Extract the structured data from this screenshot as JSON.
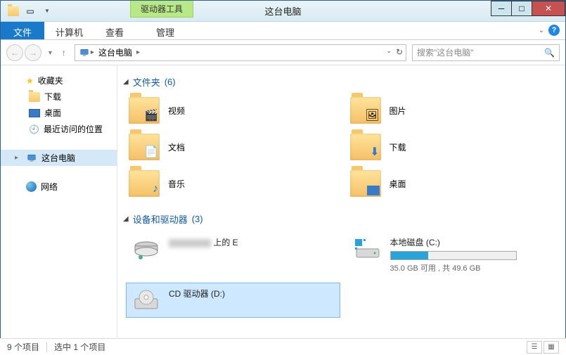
{
  "window": {
    "title": "这台电脑",
    "context_tab": "驱动器工具"
  },
  "ribbon": {
    "file": "文件",
    "tabs": [
      "计算机",
      "查看",
      "管理"
    ]
  },
  "nav": {
    "breadcrumb_root": "这台电脑",
    "search_placeholder": "搜索\"这台电脑\""
  },
  "sidebar": {
    "favorites": {
      "label": "收藏夹",
      "items": [
        "下载",
        "桌面",
        "最近访问的位置"
      ]
    },
    "thispc": {
      "label": "这台电脑"
    },
    "network": {
      "label": "网络"
    }
  },
  "groups": {
    "folders": {
      "header": "文件夹",
      "count": "(6)",
      "items": [
        "视频",
        "图片",
        "文档",
        "下载",
        "音乐",
        "桌面"
      ]
    },
    "drives": {
      "header": "设备和驱动器",
      "count": "(3)",
      "items": [
        {
          "title_suffix": "上的 E",
          "sub": ""
        },
        {
          "title": "本地磁盘 (C:)",
          "sub": "35.0 GB 可用 , 共 49.6 GB",
          "fill_pct": 30
        },
        {
          "title": "CD 驱动器 (D:)",
          "sub": ""
        }
      ]
    }
  },
  "status": {
    "count": "9 个项目",
    "selected": "选中 1 个项目"
  }
}
